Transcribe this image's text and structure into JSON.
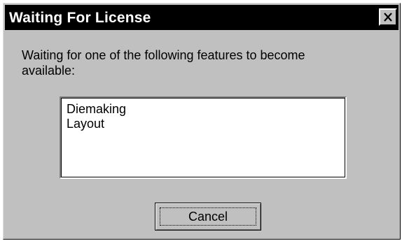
{
  "window": {
    "title": "Waiting For License",
    "close_icon": "close-icon"
  },
  "message": {
    "text": "Waiting for one of the following features to become available:"
  },
  "features_list": {
    "items": [
      "Diemaking",
      "Layout"
    ]
  },
  "buttons": {
    "cancel_label": "Cancel"
  },
  "colors": {
    "dialog_background": "#c0c0c0",
    "titlebar_background": "#000000",
    "titlebar_text": "#ffffff",
    "list_background": "#ffffff"
  }
}
